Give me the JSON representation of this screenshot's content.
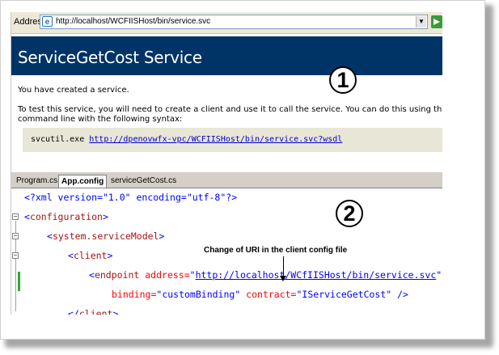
{
  "browser": {
    "address_label": "Address",
    "address_url": "http://localhost/WCFIISHost/bin/service.svc"
  },
  "service_page": {
    "title": "ServiceGetCost Service",
    "created_text": "You have created a service.",
    "instructions_line1": "To test this service, you will need to create a client and use it to call the service. You can do this using the svcutil.exe tool",
    "instructions_line2": "command line with the following syntax:",
    "command": "svcutil.exe",
    "wsdl_link": "http://dpenovwfx-vpc/WCFIISHost/bin/service.svc?wsdl"
  },
  "callouts": {
    "one": "1",
    "two": "2"
  },
  "annotation": "Change of URI in the client config file",
  "editor": {
    "tabs": [
      "Program.cs",
      "App.config",
      "serviceGetCost.cs"
    ],
    "active_tab": "App.config",
    "code": {
      "l1_a": "<?xml version=",
      "l1_b": "\"1.0\"",
      "l1_c": " encoding=",
      "l1_d": "\"utf-8\"",
      "l1_e": "?>",
      "l2": "configuration",
      "l3": "system.serviceModel",
      "l4": "client",
      "l5_tag": "endpoint",
      "l5_attr": " address=",
      "l5_url": "http://localhost/WCfIISHost/bin/service.svc",
      "l5_after": "\" b",
      "l6_attr1": "binding=",
      "l6_val1": "\"customBinding\"",
      "l6_attr2": " contract=",
      "l6_val2": "\"IServiceGetCost\"",
      "l6_end": " />",
      "l7": "client"
    }
  }
}
